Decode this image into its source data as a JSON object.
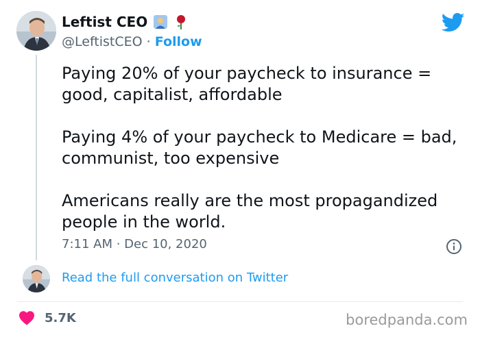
{
  "author": {
    "display_name": "Leftist CEO",
    "handle": "@LeftistCEO",
    "separator": " · ",
    "follow_label": "Follow",
    "emojis": [
      "office-worker-emoji",
      "rose-emoji"
    ]
  },
  "tweet": {
    "paragraphs": [
      "Paying 20% of your paycheck to insurance = good, capitalist, affordable",
      "Paying 4% of your paycheck to Medicare = bad, communist, too expensive",
      "Americans really are the most propagandized people in the world."
    ],
    "timestamp": "7:11 AM · Dec 10, 2020"
  },
  "conversation_link": "Read the full conversation on Twitter",
  "likes": {
    "count": "5.7K"
  },
  "watermark": "boredpanda.com",
  "colors": {
    "twitter_blue": "#1d9bf0",
    "heart": "#f91880",
    "text": "#0f1419",
    "muted": "#536471"
  },
  "icons": [
    "twitter-bird-icon",
    "info-icon",
    "heart-icon"
  ]
}
